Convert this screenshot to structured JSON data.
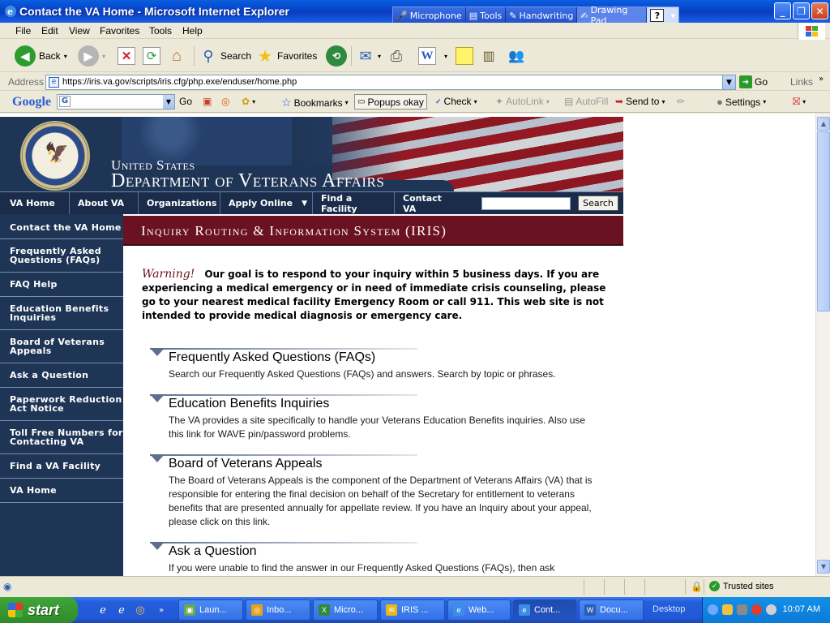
{
  "window": {
    "title": "Contact the VA Home - Microsoft Internet Explorer",
    "language_bar": [
      "Microphone",
      "Tools",
      "Handwriting",
      "Drawing Pad",
      "?"
    ],
    "controls": {
      "minimize": "_",
      "maximize": "❐",
      "close": "✕"
    }
  },
  "menu": [
    "File",
    "Edit",
    "View",
    "Favorites",
    "Tools",
    "Help"
  ],
  "toolbar": {
    "back": "Back",
    "search": "Search",
    "favorites": "Favorites"
  },
  "address": {
    "label": "Address",
    "url": "https://iris.va.gov/scripts/iris.cfg/php.exe/enduser/home.php",
    "go": "Go",
    "links": "Links"
  },
  "google_bar": {
    "logo": "Google",
    "go": "Go",
    "bookmarks": "Bookmarks",
    "popups": "Popups okay",
    "check": "Check",
    "autolink": "AutoLink",
    "autofill": "AutoFill",
    "send_to": "Send to",
    "settings": "Settings"
  },
  "va": {
    "header_line1": "United States",
    "header_line2": "Department of Veterans Affairs",
    "nav": [
      "VA Home",
      "About VA",
      "Organizations",
      "Apply Online",
      "Find a Facility",
      "Contact VA"
    ],
    "search_button": "Search",
    "sidebar": [
      "Contact the VA Home",
      "Frequently Asked Questions (FAQs)",
      "FAQ Help",
      "Education Benefits Inquiries",
      "Board of Veterans Appeals",
      "Ask a Question",
      "Paperwork Reduction Act Notice",
      "Toll Free Numbers for Contacting VA",
      "Find a VA Facility",
      "VA Home"
    ],
    "banner": "Inquiry Routing & Information System (IRIS)",
    "warning_label": "Warning!",
    "warning_text": "Our goal is to respond to your inquiry within 5 business days.   If you are experiencing a medical emergency or in need of immediate crisis counseling, please go to your nearest medical facility Emergency Room or call 911.   This web site is not intended to provide medical diagnosis or emergency care.",
    "entries": [
      {
        "title": "Frequently Asked Questions (FAQs)",
        "desc": "Search our Frequently Asked Questions (FAQs) and answers. Search by topic or phrases."
      },
      {
        "title": "Education Benefits Inquiries",
        "desc": "The VA provides a site specifically to handle your Veterans Education Benefits inquiries. Also use this link for WAVE pin/password problems."
      },
      {
        "title": "Board of Veterans Appeals",
        "desc": "The Board of Veterans Appeals is the component of the Department of Veterans Affairs (VA) that is responsible for entering the final decision on behalf of the Secretary for entitlement to veterans benefits that are presented annually for appellate review. If you have an Inquiry about your appeal, please click on this link."
      },
      {
        "title": "Ask a Question",
        "desc": "If you were unable to find the answer in our Frequently Asked Questions (FAQs), then ask"
      }
    ]
  },
  "status": {
    "zone": "Trusted sites"
  },
  "taskbar": {
    "start": "start",
    "tasks": [
      "Laun...",
      "Inbo...",
      "Micro...",
      "IRIS ...",
      "Web...",
      "Cont...",
      "Docu..."
    ],
    "desktop": "Desktop",
    "clock": "10:07 AM"
  }
}
